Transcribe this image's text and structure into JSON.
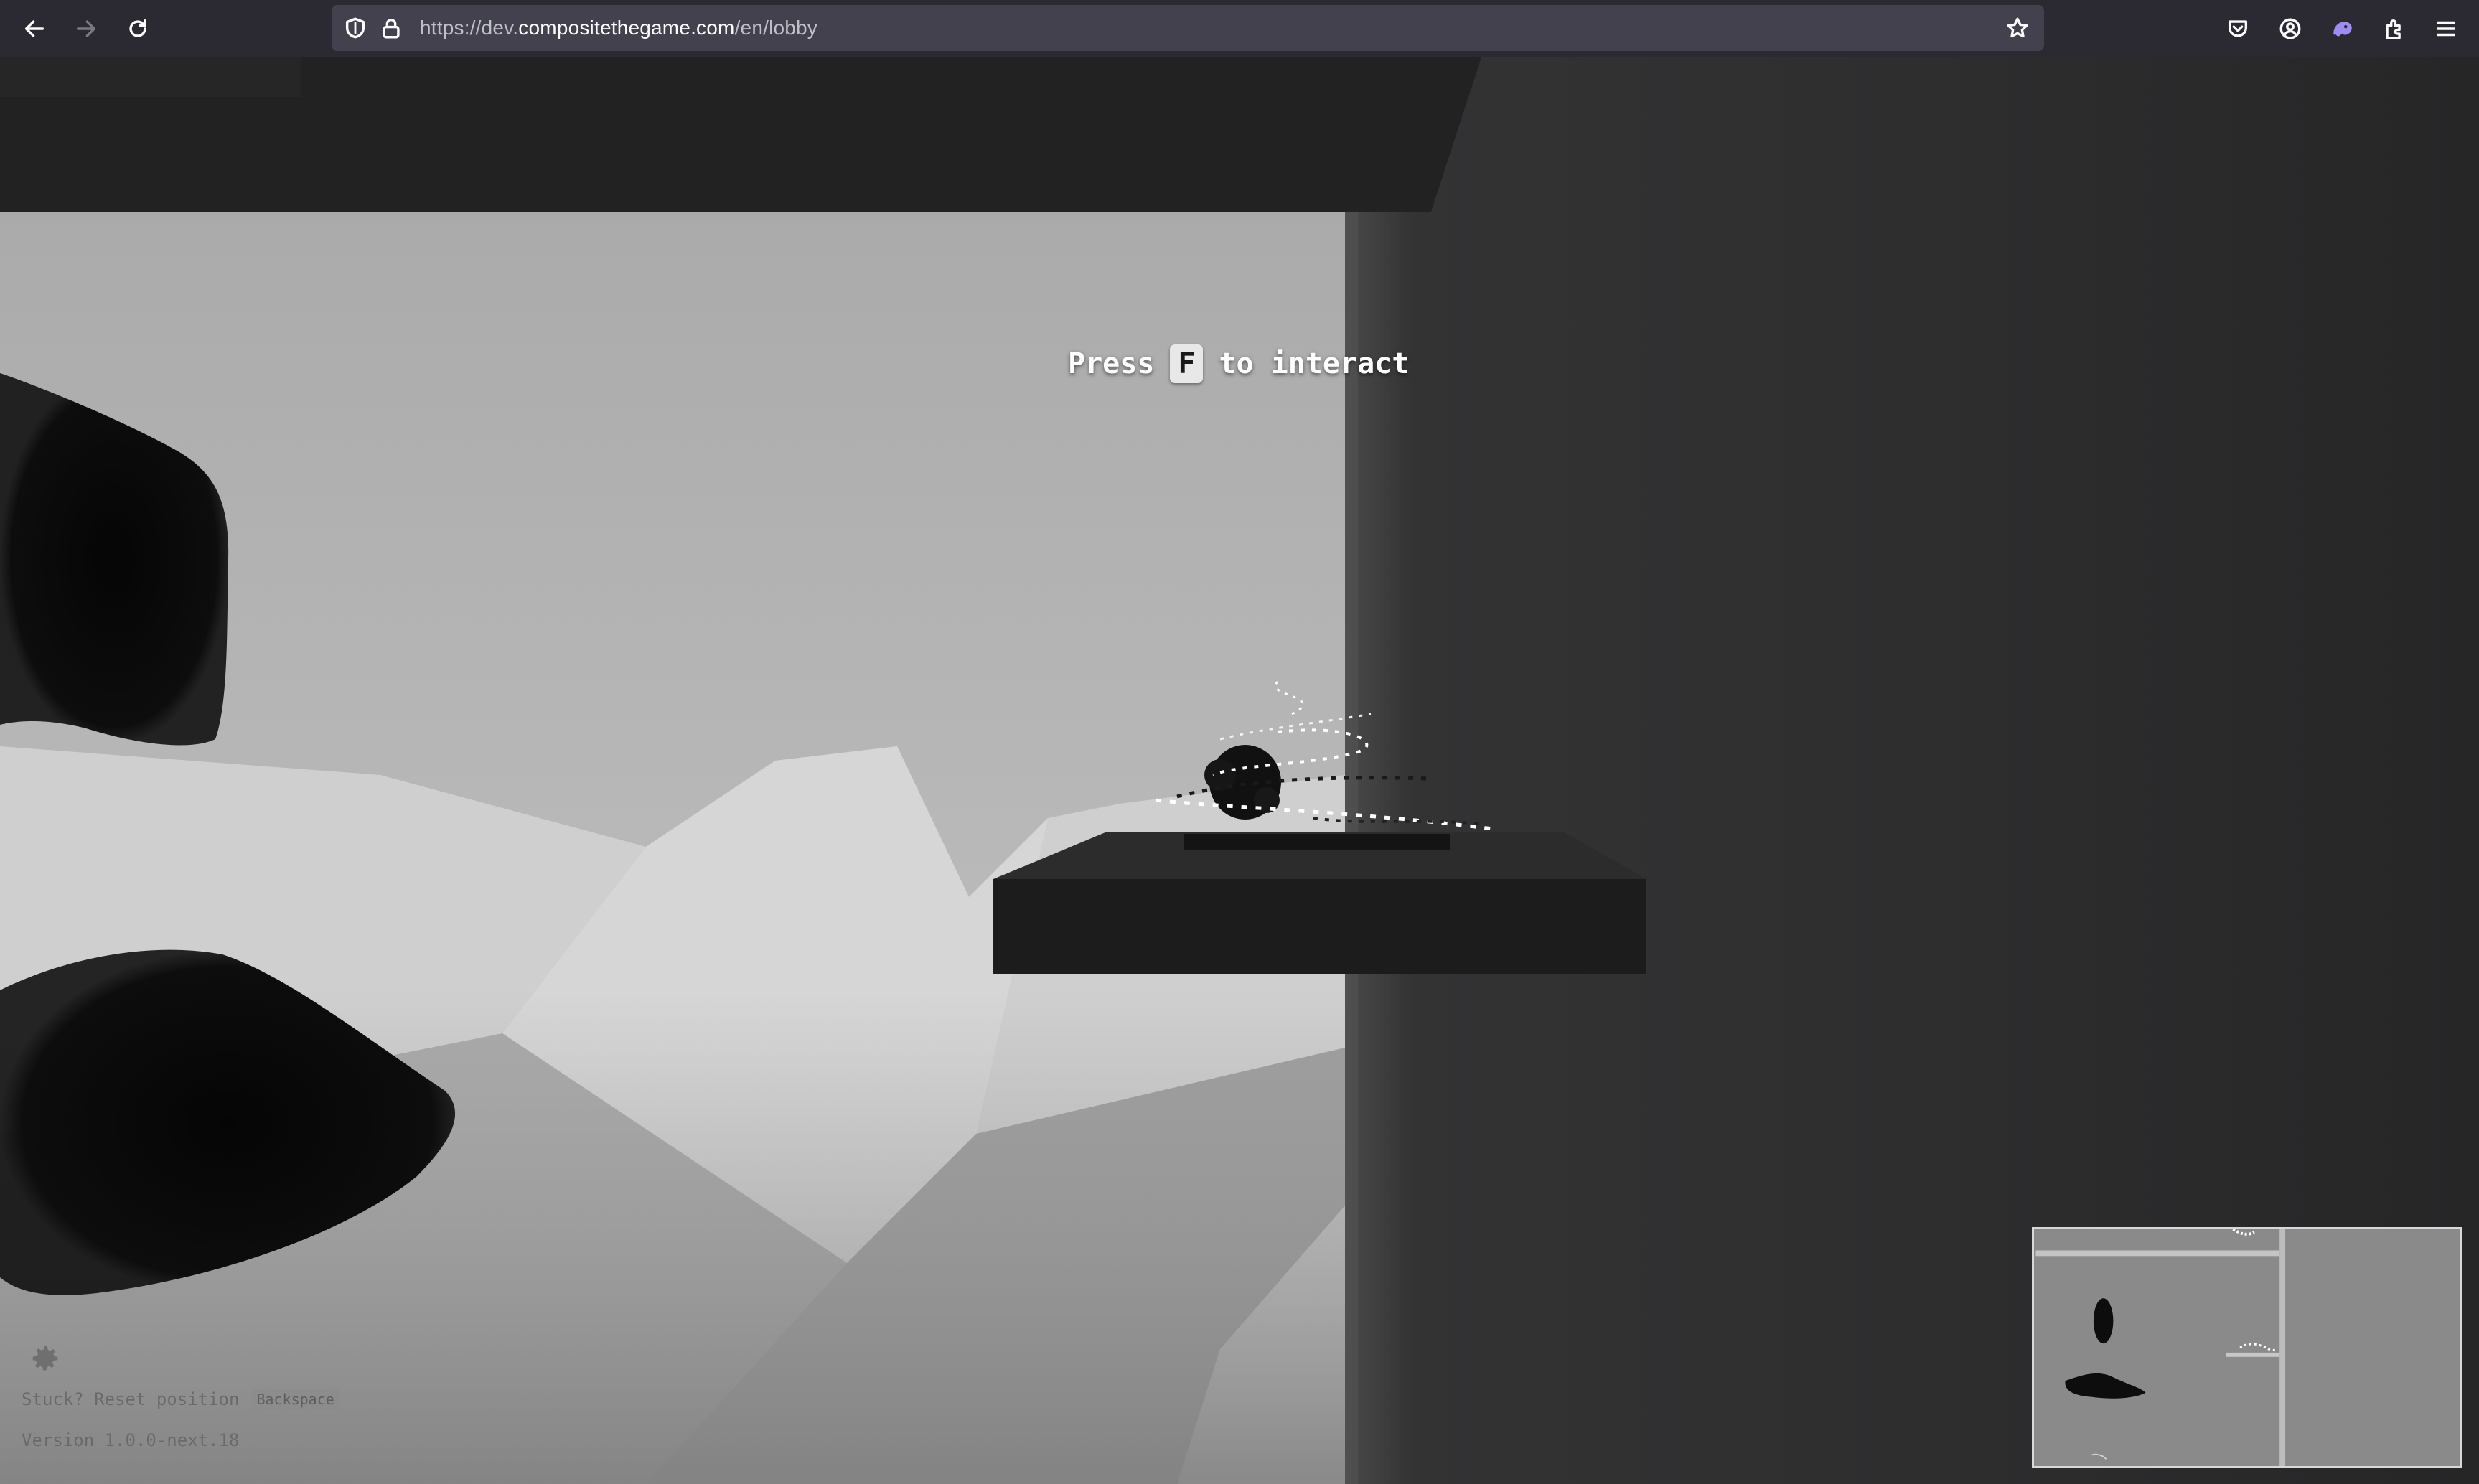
{
  "browser": {
    "url_scheme": "https://dev.",
    "url_host": "compositethegame.com",
    "url_path": "/en/lobby",
    "icons": {
      "back": "back-arrow-icon",
      "forward": "forward-arrow-icon",
      "reload": "reload-icon",
      "shield": "tracking-shield-icon",
      "lock": "lock-icon",
      "bookmark": "star-icon",
      "pocket": "pocket-icon",
      "account": "account-icon",
      "extension": "extension-icon",
      "extensions": "puzzle-icon",
      "menu": "hamburger-menu-icon"
    }
  },
  "game": {
    "prompt": {
      "before": "Press",
      "key": "F",
      "after": "to interact"
    },
    "hud": {
      "settings_icon": "gear-icon",
      "stuck_text": "Stuck? Reset position",
      "reset_key": "Backspace",
      "version": "Version 1.0.0-next.18"
    },
    "colors": {
      "sky_light": "#b7b7b7",
      "sky_dark": "#8f8f8f",
      "wall": "#2e2e2f",
      "platform": "#1e1e1e",
      "blob": "#0b0b0b"
    }
  }
}
